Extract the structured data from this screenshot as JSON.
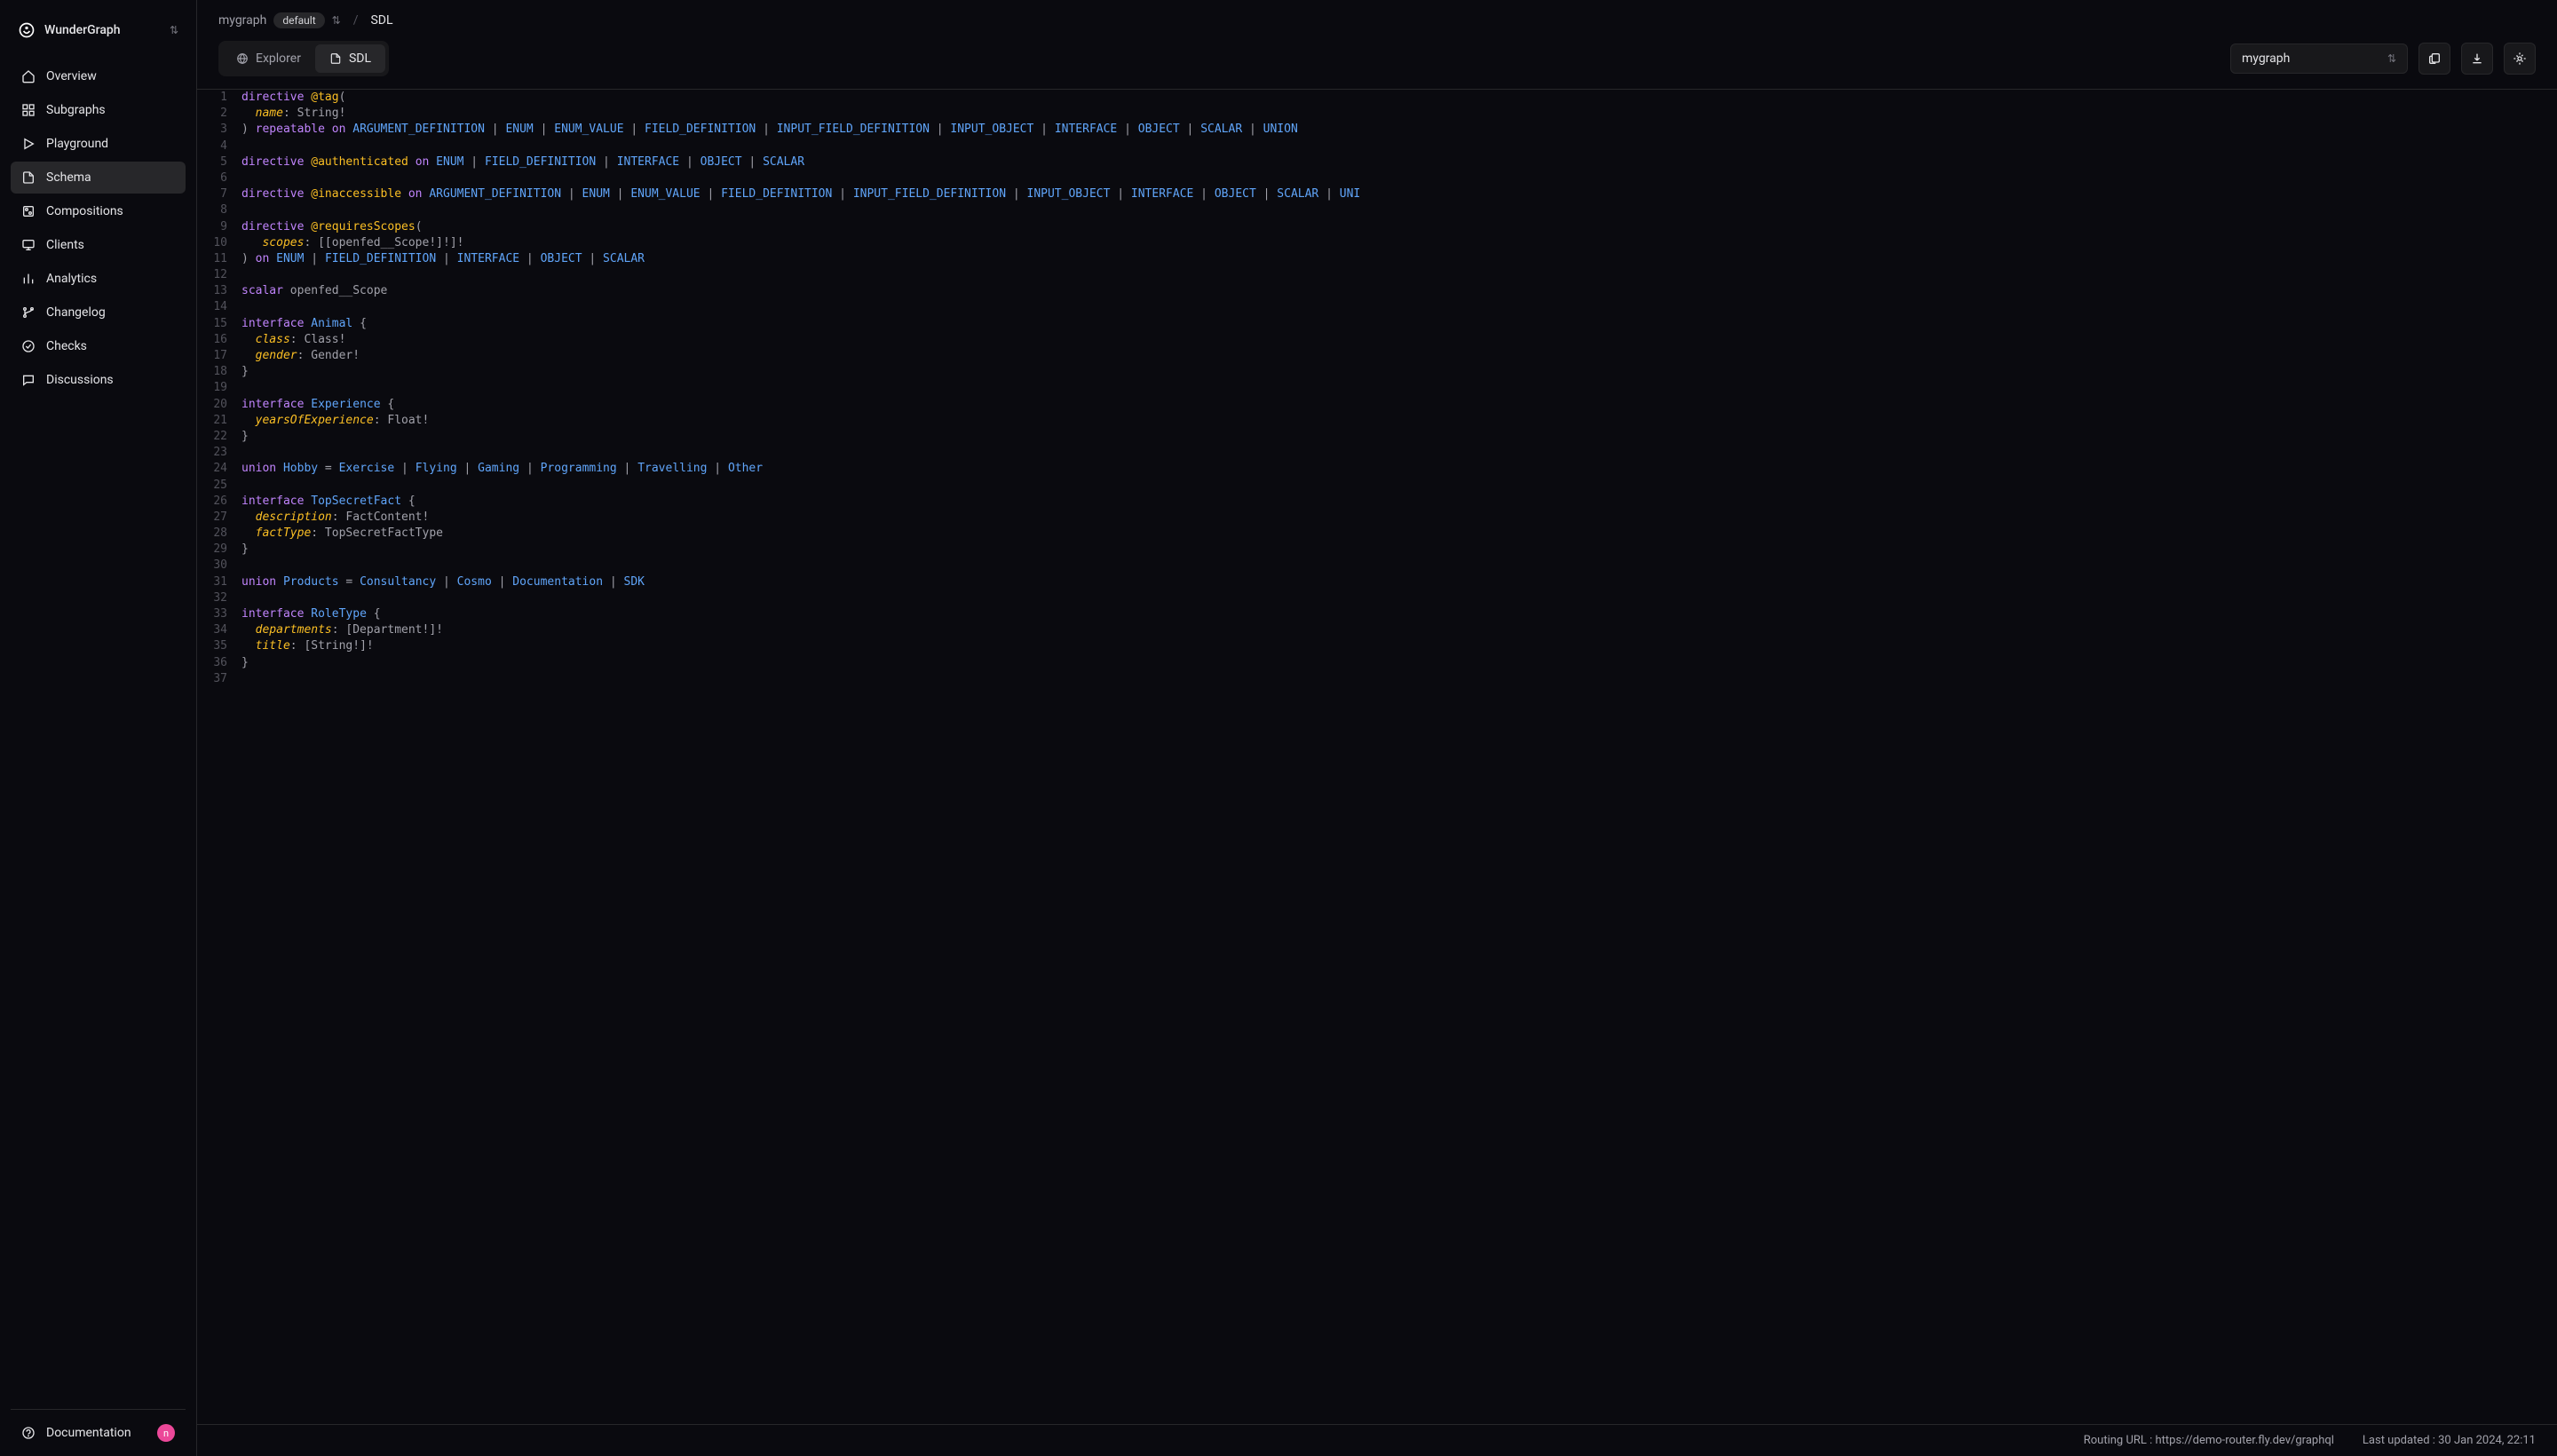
{
  "org": {
    "name": "WunderGraph"
  },
  "sidebar": {
    "items": [
      {
        "label": "Overview",
        "icon": "home"
      },
      {
        "label": "Subgraphs",
        "icon": "grid"
      },
      {
        "label": "Playground",
        "icon": "play"
      },
      {
        "label": "Schema",
        "icon": "file",
        "active": true
      },
      {
        "label": "Compositions",
        "icon": "compose"
      },
      {
        "label": "Clients",
        "icon": "monitor"
      },
      {
        "label": "Analytics",
        "icon": "bars"
      },
      {
        "label": "Changelog",
        "icon": "branch"
      },
      {
        "label": "Checks",
        "icon": "check"
      },
      {
        "label": "Discussions",
        "icon": "chat"
      }
    ],
    "documentation": "Documentation",
    "avatar": "n"
  },
  "breadcrumb": {
    "graph": "mygraph",
    "badge": "default",
    "sep": "/",
    "current": "SDL"
  },
  "tabs": [
    {
      "label": "Explorer",
      "icon": "globe"
    },
    {
      "label": "SDL",
      "icon": "file",
      "active": true
    }
  ],
  "graphSelect": {
    "value": "mygraph"
  },
  "statusbar": {
    "routing": "Routing URL : https://demo-router.fly.dev/graphql",
    "updated": "Last updated : 30 Jan 2024, 22:11"
  },
  "code": [
    [
      [
        "keyword",
        "directive"
      ],
      [
        "punct",
        " "
      ],
      [
        "directive",
        "@tag"
      ],
      [
        "punct",
        "("
      ]
    ],
    [
      [
        "punct",
        "  "
      ],
      [
        "field",
        "name"
      ],
      [
        "punct",
        ": String!"
      ]
    ],
    [
      [
        "punct",
        ") "
      ],
      [
        "keyword",
        "repeatable"
      ],
      [
        "punct",
        " "
      ],
      [
        "keyword",
        "on"
      ],
      [
        "punct",
        " "
      ],
      [
        "type",
        "ARGUMENT_DEFINITION"
      ],
      [
        "pipe",
        " | "
      ],
      [
        "type",
        "ENUM"
      ],
      [
        "pipe",
        " | "
      ],
      [
        "type",
        "ENUM_VALUE"
      ],
      [
        "pipe",
        " | "
      ],
      [
        "type",
        "FIELD_DEFINITION"
      ],
      [
        "pipe",
        " | "
      ],
      [
        "type",
        "INPUT_FIELD_DEFINITION"
      ],
      [
        "pipe",
        " | "
      ],
      [
        "type",
        "INPUT_OBJECT"
      ],
      [
        "pipe",
        " | "
      ],
      [
        "type",
        "INTERFACE"
      ],
      [
        "pipe",
        " | "
      ],
      [
        "type",
        "OBJECT"
      ],
      [
        "pipe",
        " | "
      ],
      [
        "type",
        "SCALAR"
      ],
      [
        "pipe",
        " | "
      ],
      [
        "type",
        "UNION"
      ]
    ],
    [],
    [
      [
        "keyword",
        "directive"
      ],
      [
        "punct",
        " "
      ],
      [
        "directive",
        "@authenticated"
      ],
      [
        "punct",
        " "
      ],
      [
        "keyword",
        "on"
      ],
      [
        "punct",
        " "
      ],
      [
        "type",
        "ENUM"
      ],
      [
        "pipe",
        " | "
      ],
      [
        "type",
        "FIELD_DEFINITION"
      ],
      [
        "pipe",
        " | "
      ],
      [
        "type",
        "INTERFACE"
      ],
      [
        "pipe",
        " | "
      ],
      [
        "type",
        "OBJECT"
      ],
      [
        "pipe",
        " | "
      ],
      [
        "type",
        "SCALAR"
      ]
    ],
    [],
    [
      [
        "keyword",
        "directive"
      ],
      [
        "punct",
        " "
      ],
      [
        "directive",
        "@inaccessible"
      ],
      [
        "punct",
        " "
      ],
      [
        "keyword",
        "on"
      ],
      [
        "punct",
        " "
      ],
      [
        "type",
        "ARGUMENT_DEFINITION"
      ],
      [
        "pipe",
        " | "
      ],
      [
        "type",
        "ENUM"
      ],
      [
        "pipe",
        " | "
      ],
      [
        "type",
        "ENUM_VALUE"
      ],
      [
        "pipe",
        " | "
      ],
      [
        "type",
        "FIELD_DEFINITION"
      ],
      [
        "pipe",
        " | "
      ],
      [
        "type",
        "INPUT_FIELD_DEFINITION"
      ],
      [
        "pipe",
        " | "
      ],
      [
        "type",
        "INPUT_OBJECT"
      ],
      [
        "pipe",
        " | "
      ],
      [
        "type",
        "INTERFACE"
      ],
      [
        "pipe",
        " | "
      ],
      [
        "type",
        "OBJECT"
      ],
      [
        "pipe",
        " | "
      ],
      [
        "type",
        "SCALAR"
      ],
      [
        "pipe",
        " | "
      ],
      [
        "type",
        "UNI"
      ]
    ],
    [],
    [
      [
        "keyword",
        "directive"
      ],
      [
        "punct",
        " "
      ],
      [
        "directive",
        "@requiresScopes"
      ],
      [
        "punct",
        "("
      ]
    ],
    [
      [
        "punct",
        "   "
      ],
      [
        "field",
        "scopes"
      ],
      [
        "punct",
        ": [[openfed__Scope!]!]!"
      ]
    ],
    [
      [
        "punct",
        ") "
      ],
      [
        "keyword",
        "on"
      ],
      [
        "punct",
        " "
      ],
      [
        "type",
        "ENUM"
      ],
      [
        "pipe",
        " | "
      ],
      [
        "type",
        "FIELD_DEFINITION"
      ],
      [
        "pipe",
        " | "
      ],
      [
        "type",
        "INTERFACE"
      ],
      [
        "pipe",
        " | "
      ],
      [
        "type",
        "OBJECT"
      ],
      [
        "pipe",
        " | "
      ],
      [
        "type",
        "SCALAR"
      ]
    ],
    [],
    [
      [
        "keyword",
        "scalar"
      ],
      [
        "punct",
        " openfed__Scope"
      ]
    ],
    [],
    [
      [
        "keyword",
        "interface"
      ],
      [
        "punct",
        " "
      ],
      [
        "type",
        "Animal"
      ],
      [
        "punct",
        " {"
      ]
    ],
    [
      [
        "punct",
        "  "
      ],
      [
        "field",
        "class"
      ],
      [
        "punct",
        ": Class!"
      ]
    ],
    [
      [
        "punct",
        "  "
      ],
      [
        "field",
        "gender"
      ],
      [
        "punct",
        ": Gender!"
      ]
    ],
    [
      [
        "punct",
        "}"
      ]
    ],
    [],
    [
      [
        "keyword",
        "interface"
      ],
      [
        "punct",
        " "
      ],
      [
        "type",
        "Experience"
      ],
      [
        "punct",
        " {"
      ]
    ],
    [
      [
        "punct",
        "  "
      ],
      [
        "field",
        "yearsOfExperience"
      ],
      [
        "punct",
        ": Float!"
      ]
    ],
    [
      [
        "punct",
        "}"
      ]
    ],
    [],
    [
      [
        "keyword",
        "union"
      ],
      [
        "punct",
        " "
      ],
      [
        "type",
        "Hobby"
      ],
      [
        "punct",
        " = "
      ],
      [
        "type",
        "Exercise"
      ],
      [
        "pipe",
        " | "
      ],
      [
        "type",
        "Flying"
      ],
      [
        "pipe",
        " | "
      ],
      [
        "type",
        "Gaming"
      ],
      [
        "pipe",
        " | "
      ],
      [
        "type",
        "Programming"
      ],
      [
        "pipe",
        " | "
      ],
      [
        "type",
        "Travelling"
      ],
      [
        "pipe",
        " | "
      ],
      [
        "type",
        "Other"
      ]
    ],
    [],
    [
      [
        "keyword",
        "interface"
      ],
      [
        "punct",
        " "
      ],
      [
        "type",
        "TopSecretFact"
      ],
      [
        "punct",
        " {"
      ]
    ],
    [
      [
        "punct",
        "  "
      ],
      [
        "field",
        "description"
      ],
      [
        "punct",
        ": FactContent!"
      ]
    ],
    [
      [
        "punct",
        "  "
      ],
      [
        "field",
        "factType"
      ],
      [
        "punct",
        ": TopSecretFactType"
      ]
    ],
    [
      [
        "punct",
        "}"
      ]
    ],
    [],
    [
      [
        "keyword",
        "union"
      ],
      [
        "punct",
        " "
      ],
      [
        "type",
        "Products"
      ],
      [
        "punct",
        " = "
      ],
      [
        "type",
        "Consultancy"
      ],
      [
        "pipe",
        " | "
      ],
      [
        "type",
        "Cosmo"
      ],
      [
        "pipe",
        " | "
      ],
      [
        "type",
        "Documentation"
      ],
      [
        "pipe",
        " | "
      ],
      [
        "type",
        "SDK"
      ]
    ],
    [],
    [
      [
        "keyword",
        "interface"
      ],
      [
        "punct",
        " "
      ],
      [
        "type",
        "RoleType"
      ],
      [
        "punct",
        " {"
      ]
    ],
    [
      [
        "punct",
        "  "
      ],
      [
        "field",
        "departments"
      ],
      [
        "punct",
        ": [Department!]!"
      ]
    ],
    [
      [
        "punct",
        "  "
      ],
      [
        "field",
        "title"
      ],
      [
        "punct",
        ": [String!]!"
      ]
    ],
    [
      [
        "punct",
        "}"
      ]
    ],
    []
  ]
}
